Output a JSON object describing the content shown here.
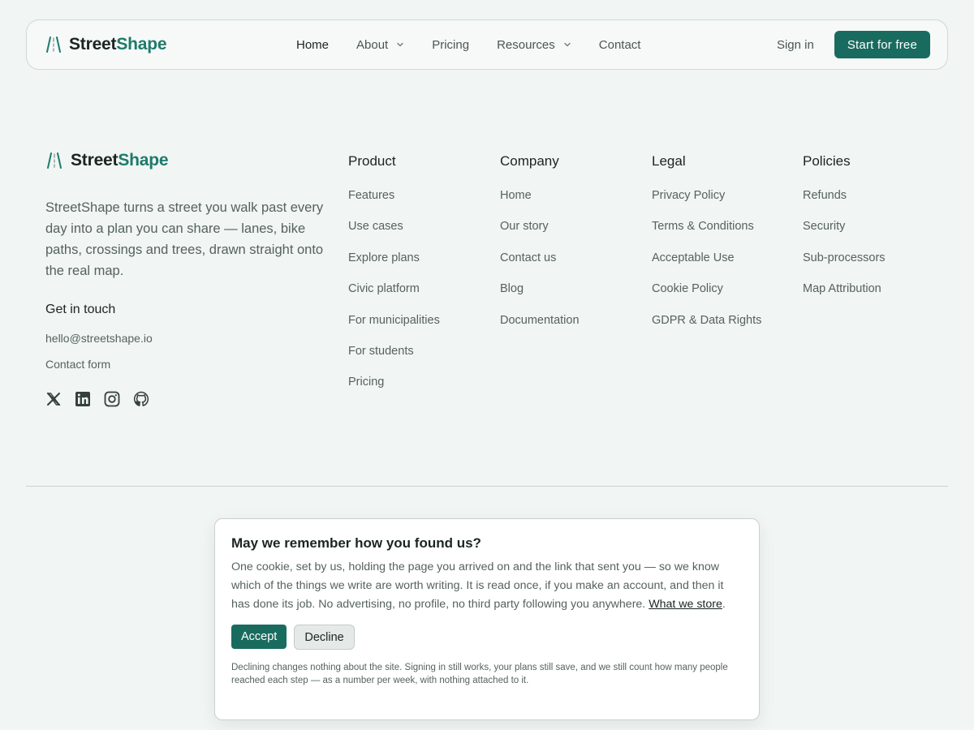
{
  "brand": {
    "part1": "Street",
    "part2": "Shape",
    "logo_icon": "road-lanes-icon",
    "accent_color": "#1e7a6c"
  },
  "nav": {
    "links": [
      {
        "label": "Home",
        "active": true,
        "has_dropdown": false
      },
      {
        "label": "About",
        "active": false,
        "has_dropdown": true
      },
      {
        "label": "Pricing",
        "active": false,
        "has_dropdown": false
      },
      {
        "label": "Resources",
        "active": false,
        "has_dropdown": true
      },
      {
        "label": "Contact",
        "active": false,
        "has_dropdown": false
      }
    ],
    "sign_in": "Sign in",
    "cta": "Start for free",
    "cta_color": "#1a6b5f"
  },
  "footer": {
    "about": "StreetShape turns a street you walk past every day into a plan you can share — lanes, bike paths, crossings and trees, drawn straight onto the real map.",
    "contact": {
      "title": "Get in touch",
      "email": "hello@streetshape.io",
      "form": "Contact form"
    },
    "socials": [
      "x-icon",
      "linkedin-icon",
      "instagram-icon",
      "github-icon"
    ],
    "columns": [
      {
        "title": "Product",
        "items": [
          "Features",
          "Use cases",
          "Explore plans",
          "Civic platform",
          "For municipalities",
          "For students",
          "Pricing"
        ]
      },
      {
        "title": "Company",
        "items": [
          "Home",
          "Our story",
          "Contact us",
          "Blog",
          "Documentation"
        ]
      },
      {
        "title": "Legal",
        "items": [
          "Privacy Policy",
          "Terms & Conditions",
          "Acceptable Use",
          "Cookie Policy",
          "GDPR & Data Rights"
        ]
      },
      {
        "title": "Policies",
        "items": [
          "Refunds",
          "Security",
          "Sub-processors",
          "Map Attribution"
        ]
      }
    ]
  },
  "cookie": {
    "title": "May we remember how you found us?",
    "body": "One cookie, set by us, holding the page you arrived on and the link that sent you — so we know which of the things we write are worth writing. It is read once, if you make an account, and then it has done its job. No advertising, no profile, no third party following you anywhere. ",
    "link": "What we store",
    "body_end": ".",
    "accept": "Accept",
    "decline": "Decline",
    "note": "Declining changes nothing about the site. Signing in still works, your plans still save, and we still count how many people reached each step — as a number per week, with nothing attached to it."
  }
}
